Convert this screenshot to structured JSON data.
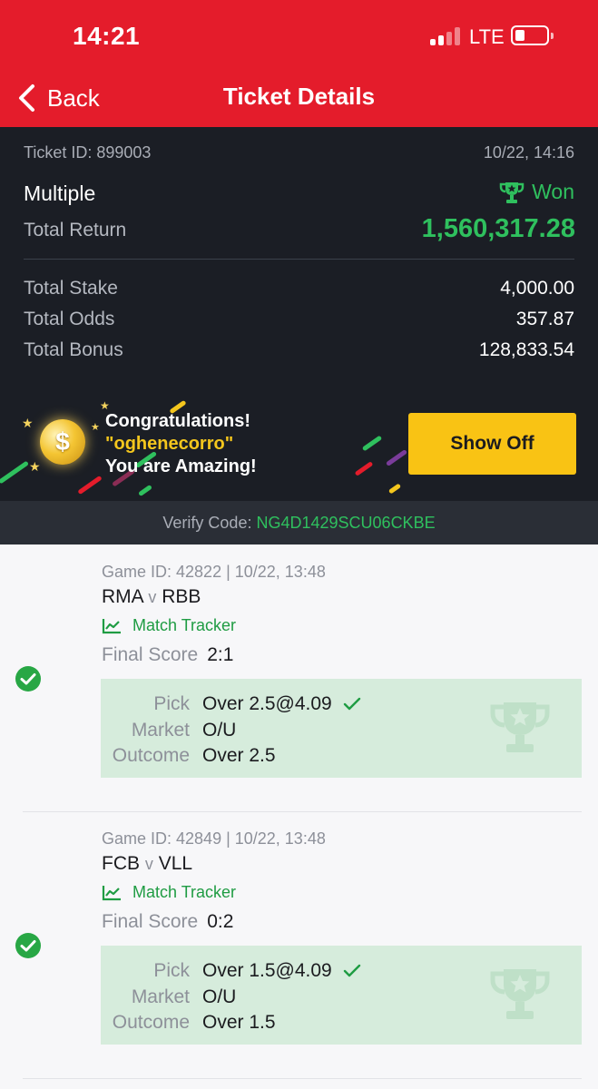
{
  "status_bar": {
    "time": "14:21",
    "network": "LTE"
  },
  "nav": {
    "back_label": "Back",
    "title": "Ticket Details"
  },
  "ticket": {
    "id_text": "Ticket ID: 899003",
    "datetime": "10/22, 14:16",
    "bet_type": "Multiple",
    "status": "Won",
    "total_return_label": "Total Return",
    "total_return_value": "1,560,317.28",
    "rows": [
      {
        "label": "Total Stake",
        "value": "4,000.00"
      },
      {
        "label": "Total Odds",
        "value": "357.87"
      },
      {
        "label": "Total Bonus",
        "value": "128,833.54"
      }
    ]
  },
  "banner": {
    "line1": "Congratulations!",
    "line2": "\"oghenecorro\"",
    "line3": "You are Amazing!",
    "coin_symbol": "$",
    "button_label": "Show Off"
  },
  "verify": {
    "label": "Verify Code:",
    "code": "NG4D1429SCU06CKBE"
  },
  "selections": [
    {
      "game_line": "Game ID: 42822 | 10/22, 13:48",
      "home": "RMA",
      "vs": "v",
      "away": "RBB",
      "tracker_label": "Match Tracker",
      "final_label": "Final Score",
      "final_score": "2:1",
      "pick_label": "Pick",
      "pick_value": "Over 2.5@4.09",
      "market_label": "Market",
      "market_value": "O/U",
      "outcome_label": "Outcome",
      "outcome_value": "Over 2.5"
    },
    {
      "game_line": "Game ID: 42849 | 10/22, 13:48",
      "home": "FCB",
      "vs": "v",
      "away": "VLL",
      "tracker_label": "Match Tracker",
      "final_label": "Final Score",
      "final_score": "0:2",
      "pick_label": "Pick",
      "pick_value": "Over 1.5@4.09",
      "market_label": "Market",
      "market_value": "O/U",
      "outcome_label": "Outcome",
      "outcome_value": "Over 1.5"
    }
  ],
  "colors": {
    "header_red": "#e41c2b",
    "summary_dark": "#1b1e25",
    "won_green": "#2fc05e",
    "button_yellow": "#f9c314",
    "pick_box_green": "#d6ecdc"
  },
  "icons": [
    "back-chevron-icon",
    "trophy-icon",
    "check-circle-icon",
    "chart-line-icon",
    "checkmark-icon",
    "coin-icon"
  ]
}
